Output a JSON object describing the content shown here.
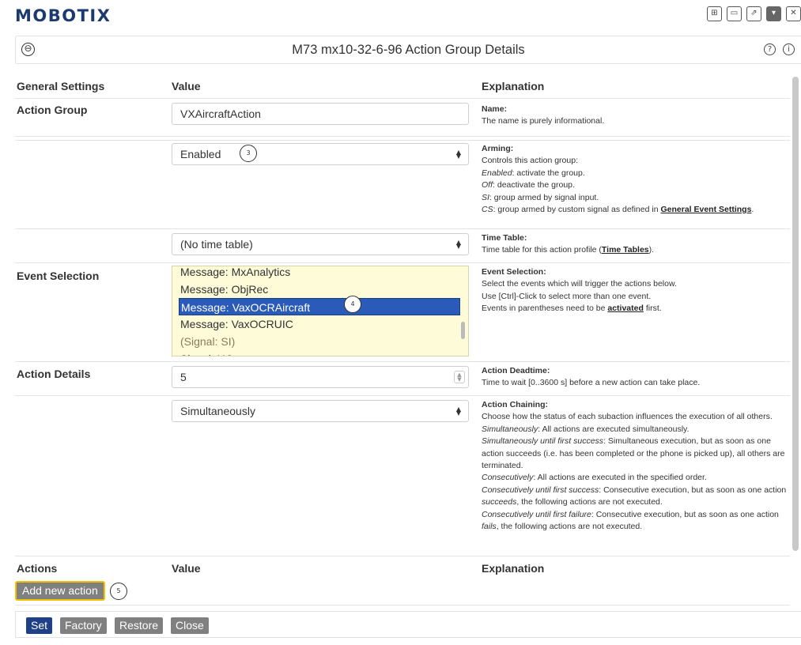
{
  "app": {
    "logo": "MOBOTIX",
    "top_icons": [
      {
        "name": "grid-icon",
        "glyph": "⊞"
      },
      {
        "name": "window-icon",
        "glyph": "▭"
      },
      {
        "name": "external-link-icon",
        "glyph": "⇗"
      },
      {
        "name": "dropdown-icon",
        "glyph": "▾"
      },
      {
        "name": "close-icon",
        "glyph": "✕"
      }
    ]
  },
  "header": {
    "title": "M73 mx10-32-6-96   Action Group Details",
    "back_icon": "⊖",
    "help_icon": "?",
    "info_icon": "i"
  },
  "columns": {
    "c1": "General Settings",
    "c2": "Value",
    "c3": "Explanation"
  },
  "rows": {
    "action_group": {
      "label": "Action Group",
      "value": "VXAircraftAction",
      "exp_title": "Name",
      "exp_text": "The name is purely informational."
    },
    "arming": {
      "value": "Enabled",
      "marker": "3",
      "exp_title": "Arming",
      "exp_intro": "Controls this action group:",
      "exp_lines": [
        {
          "term": "Enabled",
          "text": ": activate the group."
        },
        {
          "term": "Off",
          "text": ": deactivate the group."
        },
        {
          "term": "SI",
          "text": ": group armed by signal input."
        },
        {
          "term": "CS",
          "text": ": group armed by custom signal as defined in "
        }
      ],
      "exp_link": "General Event Settings",
      "exp_link_suffix": "."
    },
    "time_table": {
      "value": "(No time table)",
      "exp_title": "Time Table",
      "exp_text": "Time table for this action profile (",
      "exp_link": "Time Tables",
      "exp_suffix": ")."
    },
    "event_selection": {
      "label": "Event Selection",
      "options": [
        "Message: MxAnalytics",
        "Message: ObjRec",
        "Message: VaxOCRAircraft",
        "Message: VaxOCRUIC",
        "(Signal: SI)",
        "Signal: UC"
      ],
      "selected_index": 2,
      "marker": "4",
      "exp_title": "Event Selection",
      "exp_lines": [
        "Select the events which will trigger the actions below.",
        "Use [Ctrl]-Click to select more than one event."
      ],
      "exp_last_prefix": "Events in parentheses need to be ",
      "exp_link": "activated",
      "exp_last_suffix": " first."
    },
    "deadtime": {
      "label": "Action Details",
      "value": "5",
      "exp_title": "Action Deadtime",
      "exp_text": "Time to wait [0..3600 s] before a new action can take place."
    },
    "chaining": {
      "value": "Simultaneously",
      "exp_title": "Action Chaining",
      "exp_intro": "Choose how the status of each subaction influences the execution of all others.",
      "exp_items": [
        {
          "term": "Simultaneously",
          "text": ": All actions are executed simultaneously."
        },
        {
          "term": "Simultaneously until first success",
          "text": ": Simultaneous execution, but as soon as one action succeeds (i.e. has been completed or the phone is picked up), all others are terminated."
        },
        {
          "term": "Consecutively",
          "text": ": All actions are executed in the specified order."
        },
        {
          "term": "Consecutively until first success",
          "text": ": Consecutive execution, but as soon as one action "
        },
        {
          "term": "Consecutively until first failure",
          "text": ": Consecutive execution, but as soon as one action "
        }
      ],
      "succeeds_word": "succeeds",
      "succeeds_tail": ", the following actions are not executed.",
      "fails_word": "fails",
      "fails_tail": ", the following actions are not executed."
    }
  },
  "actions_section": {
    "c1": "Actions",
    "c2": "Value",
    "c3": "Explanation",
    "add_button": "Add new action",
    "marker": "5"
  },
  "footer": {
    "set": "Set",
    "factory": "Factory",
    "restore": "Restore",
    "close": "Close"
  }
}
